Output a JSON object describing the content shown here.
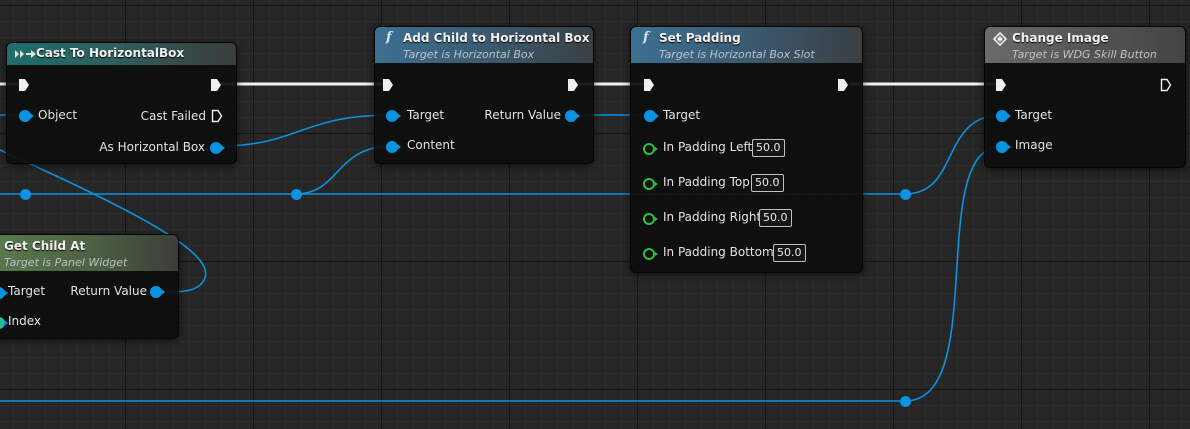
{
  "colors": {
    "exec_wire": "#f0f0f0",
    "data_wire": "#0a93e0",
    "float_pin": "#2fbf3a"
  },
  "nodes": {
    "cast": {
      "title": "Cast To HorizontalBox",
      "icon": "cast-arrows-icon",
      "object_label": "Object",
      "cast_failed_label": "Cast Failed",
      "as_horizontal_box_label": "As Horizontal Box"
    },
    "add_child": {
      "title": "Add Child to Horizontal Box",
      "subtitle": "Target is Horizontal Box",
      "icon": "function-icon",
      "target_label": "Target",
      "content_label": "Content",
      "return_value_label": "Return Value"
    },
    "set_padding": {
      "title": "Set Padding",
      "subtitle": "Target is Horizontal Box Slot",
      "icon": "function-icon",
      "target_label": "Target",
      "pads": [
        {
          "label": "In Padding Left",
          "value": "50.0"
        },
        {
          "label": "In Padding Top",
          "value": "50.0"
        },
        {
          "label": "In Padding Right",
          "value": "50.0"
        },
        {
          "label": "In Padding Bottom",
          "value": "50.0"
        }
      ]
    },
    "change_image": {
      "title": "Change Image",
      "subtitle": "Target is WDG Skill Button",
      "icon": "event-diamond-icon",
      "target_label": "Target",
      "image_label": "Image"
    },
    "get_child": {
      "title": "Get Child At",
      "subtitle": "Target is Panel Widget",
      "target_label": "Target",
      "index_label": "Index",
      "return_value_label": "Return Value"
    }
  }
}
